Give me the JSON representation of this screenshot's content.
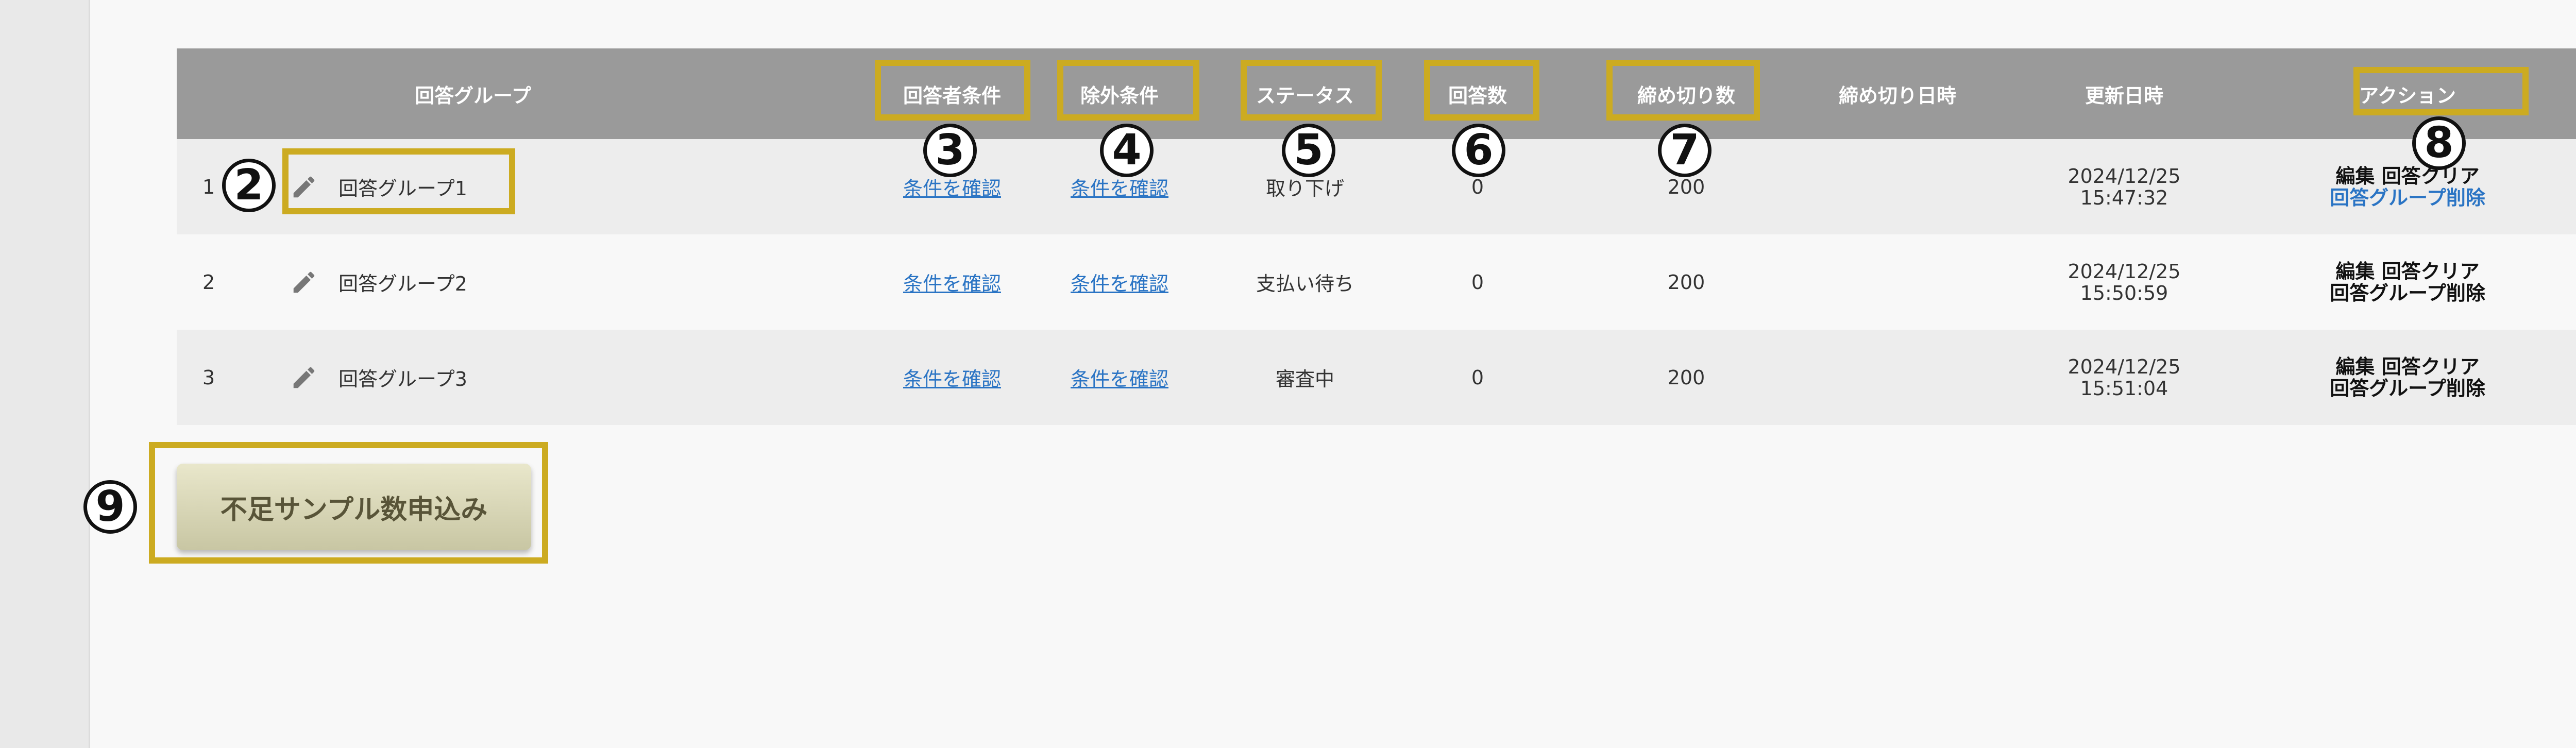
{
  "table": {
    "headers": {
      "group": "回答グループ",
      "respondent_conditions": "回答者条件",
      "exclusion_conditions": "除外条件",
      "status": "ステータス",
      "answer_count": "回答数",
      "cutoff_count": "締め切り数",
      "cutoff_datetime": "締め切り日時",
      "updated_at": "更新日時",
      "actions": "アクション"
    },
    "rows": [
      {
        "index": "1",
        "name": "回答グループ1",
        "respondent_link": "条件を確認",
        "exclusion_link": "条件を確認",
        "status": "取り下げ",
        "answer_count": "0",
        "cutoff_count": "200",
        "cutoff_datetime": "",
        "updated_date": "2024/12/25",
        "updated_time": "15:47:32",
        "action_edit": "編集",
        "action_clear": "回答クリア",
        "action_delete": "回答グループ削除"
      },
      {
        "index": "2",
        "name": "回答グループ2",
        "respondent_link": "条件を確認",
        "exclusion_link": "条件を確認",
        "status": "支払い待ち",
        "answer_count": "0",
        "cutoff_count": "200",
        "cutoff_datetime": "",
        "updated_date": "2024/12/25",
        "updated_time": "15:50:59",
        "action_edit": "編集",
        "action_clear": "回答クリア",
        "action_delete": "回答グループ削除"
      },
      {
        "index": "3",
        "name": "回答グループ3",
        "respondent_link": "条件を確認",
        "exclusion_link": "条件を確認",
        "status": "審査中",
        "answer_count": "0",
        "cutoff_count": "200",
        "cutoff_datetime": "",
        "updated_date": "2024/12/25",
        "updated_time": "15:51:04",
        "action_edit": "編集",
        "action_clear": "回答クリア",
        "action_delete": "回答グループ削除"
      }
    ]
  },
  "submit_button_label": "不足サンプル数申込み",
  "markers": {
    "m2": "2",
    "m3": "3",
    "m4": "4",
    "m5": "5",
    "m6": "6",
    "m7": "7",
    "m8": "8",
    "m9": "9"
  },
  "colors": {
    "header_bg": "#9a9a9a",
    "highlight": "#ccab21",
    "link": "#2a74c4"
  },
  "icons": {
    "edit": "pencil-icon"
  }
}
